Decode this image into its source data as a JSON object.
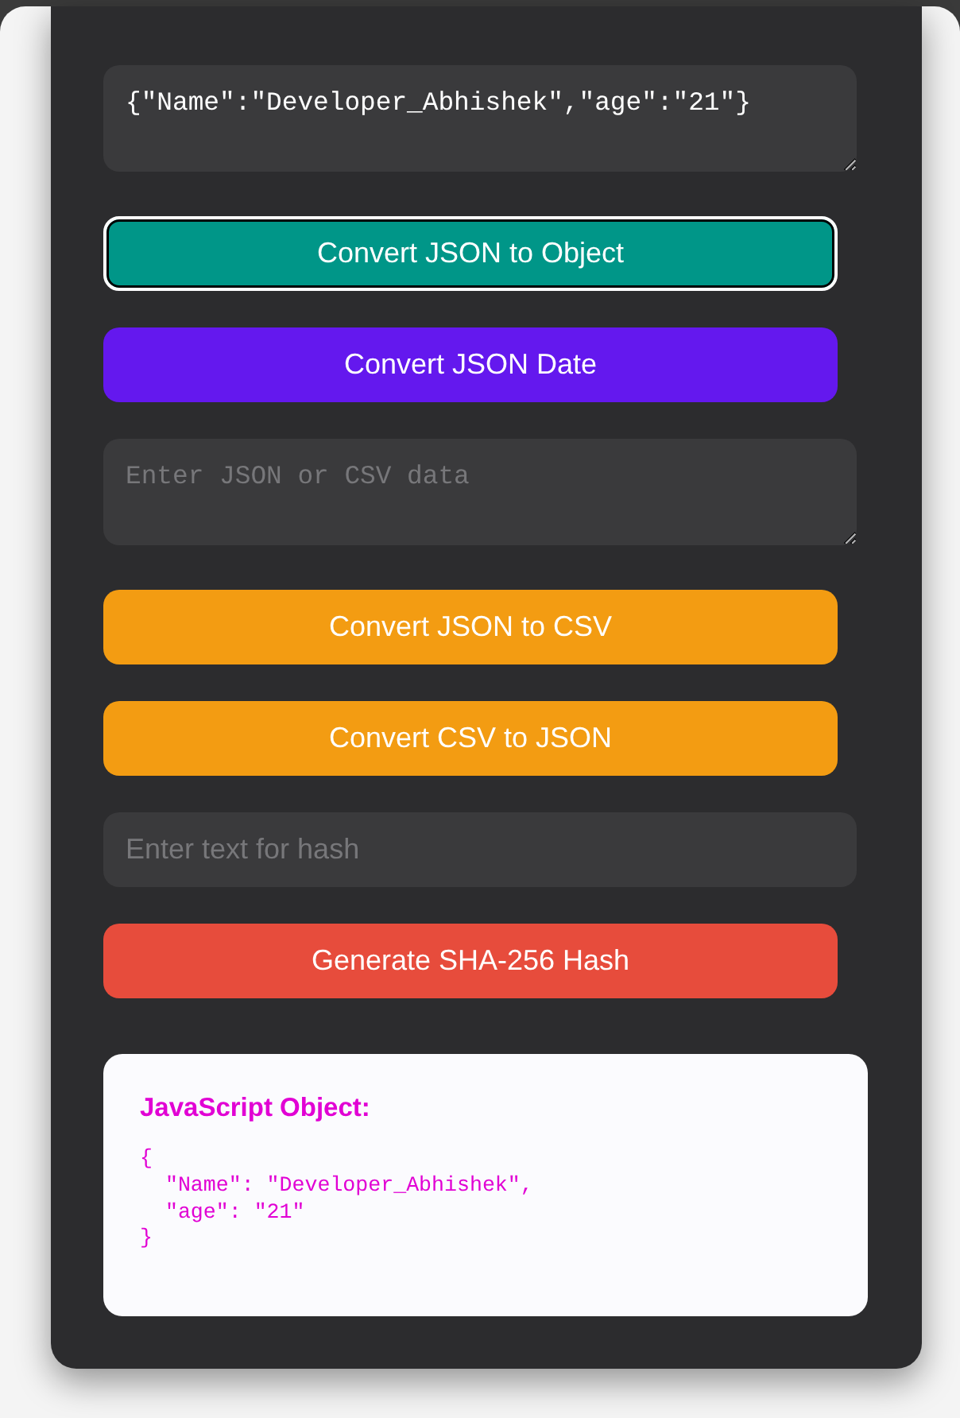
{
  "fields": [
    {
      "kind": "textarea",
      "value": "{\"Name\":\"Developer_Abhishek\",\"age\":\"21\"}"
    },
    {
      "kind": "button",
      "label": "Convert JSON to Object",
      "color": "#009688",
      "focused": true
    },
    {
      "kind": "button",
      "label": "Convert JSON Date",
      "color": "#6418ee",
      "focused": false
    },
    {
      "kind": "textarea",
      "placeholder": "Enter JSON or CSV data"
    },
    {
      "kind": "button",
      "label": "Convert JSON to CSV",
      "color": "#f39c12",
      "focused": false
    },
    {
      "kind": "button",
      "label": "Convert CSV to JSON",
      "color": "#f39c12",
      "focused": false
    },
    {
      "kind": "input",
      "placeholder": "Enter text for hash"
    },
    {
      "kind": "button",
      "label": "Generate SHA-256 Hash",
      "color": "#e74c3c",
      "focused": false
    }
  ],
  "output": {
    "title": "JavaScript Object:",
    "text": "{\n  \"Name\": \"Developer_Abhishek\",\n  \"age\": \"21\"\n}"
  }
}
